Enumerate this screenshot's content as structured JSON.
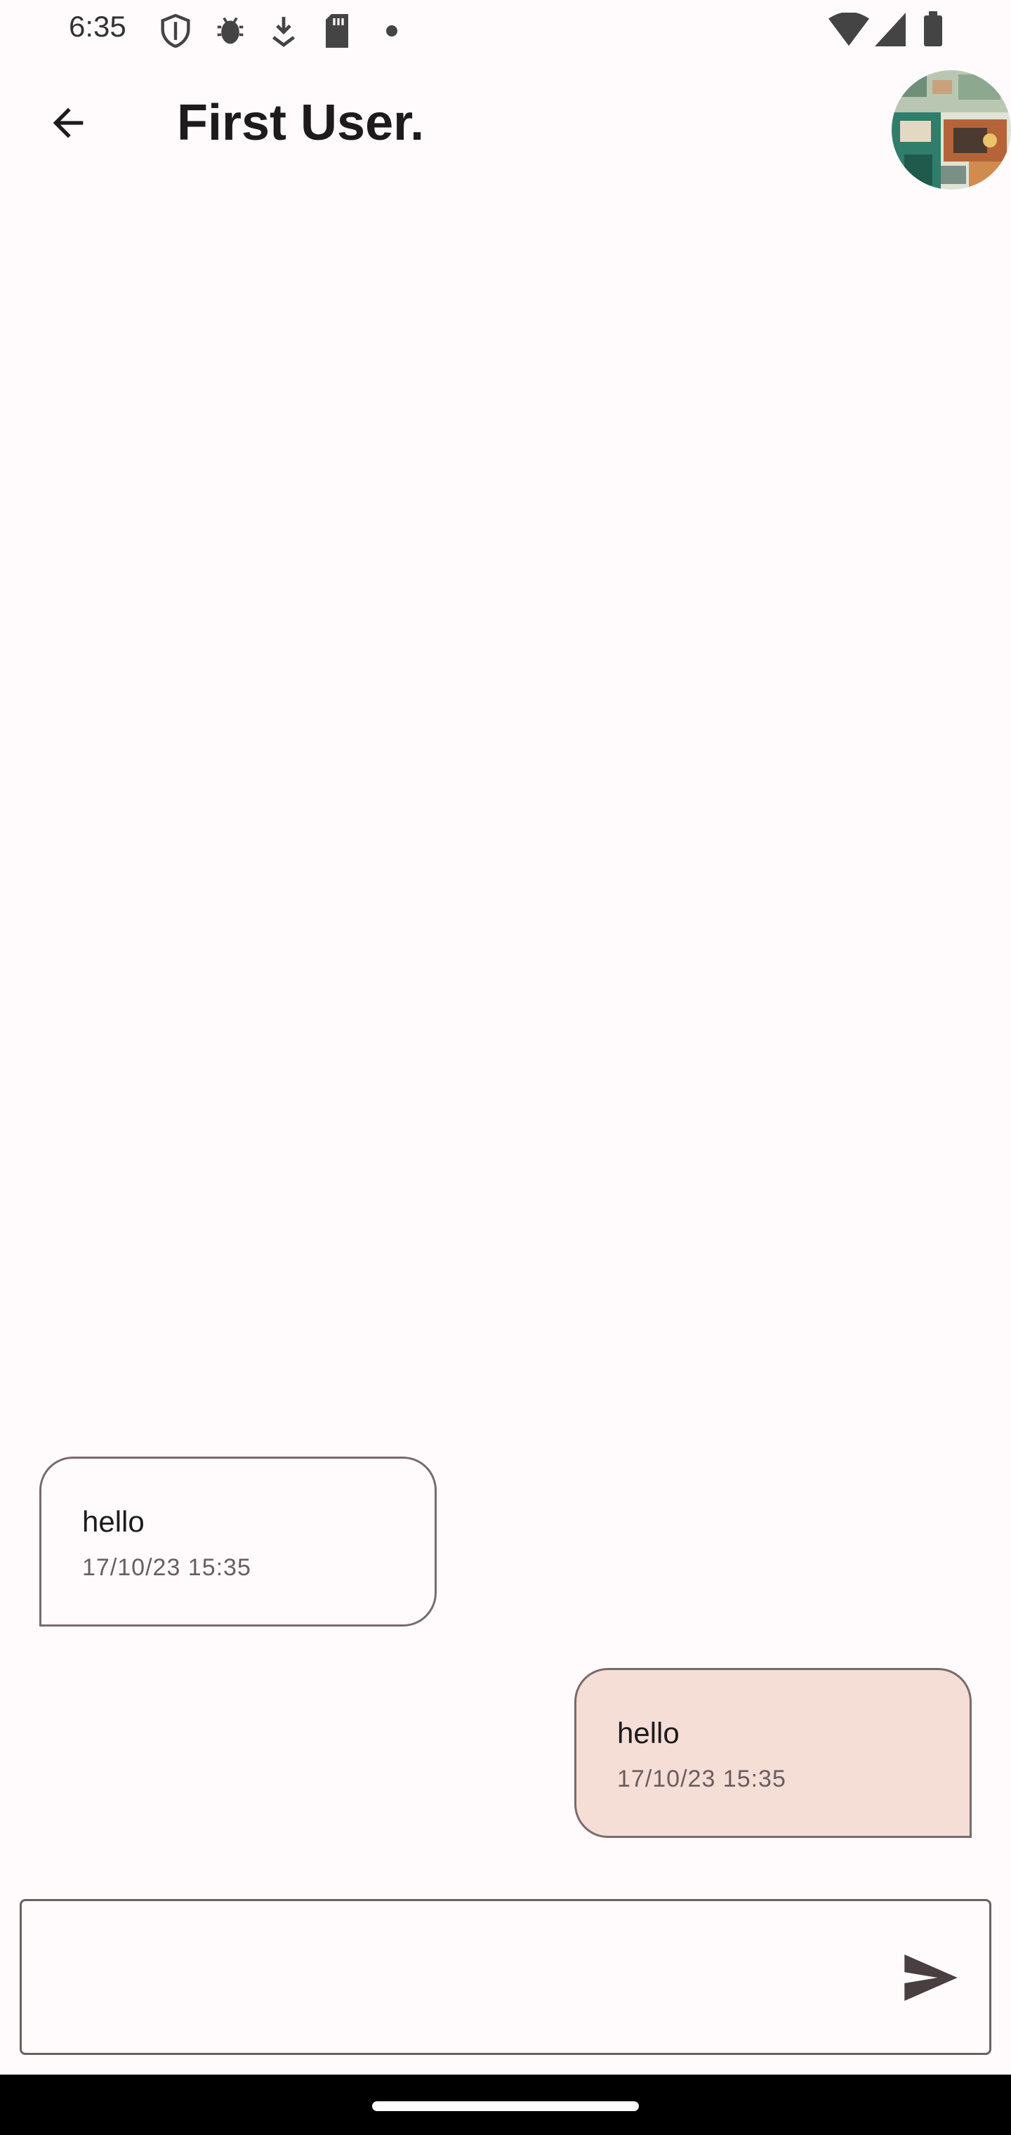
{
  "status_bar": {
    "time": "6:35",
    "icons": [
      "shield-icon",
      "bug-icon",
      "download-icon",
      "sd-card-icon",
      "notification-dot-icon",
      "wifi-icon",
      "signal-icon",
      "battery-icon"
    ]
  },
  "app_bar": {
    "title": "First User.",
    "back_icon": "arrow-back-icon"
  },
  "messages": [
    {
      "direction": "incoming",
      "text": "hello",
      "timestamp": "17/10/23 15:35"
    },
    {
      "direction": "outgoing",
      "text": "hello",
      "timestamp": "17/10/23 15:35"
    }
  ],
  "composer": {
    "value": "",
    "send_icon": "send-icon"
  },
  "colors": {
    "background": "#fffbfd",
    "outgoing_bubble": "#f5ded6",
    "bubble_border": "#7a6a6a"
  }
}
